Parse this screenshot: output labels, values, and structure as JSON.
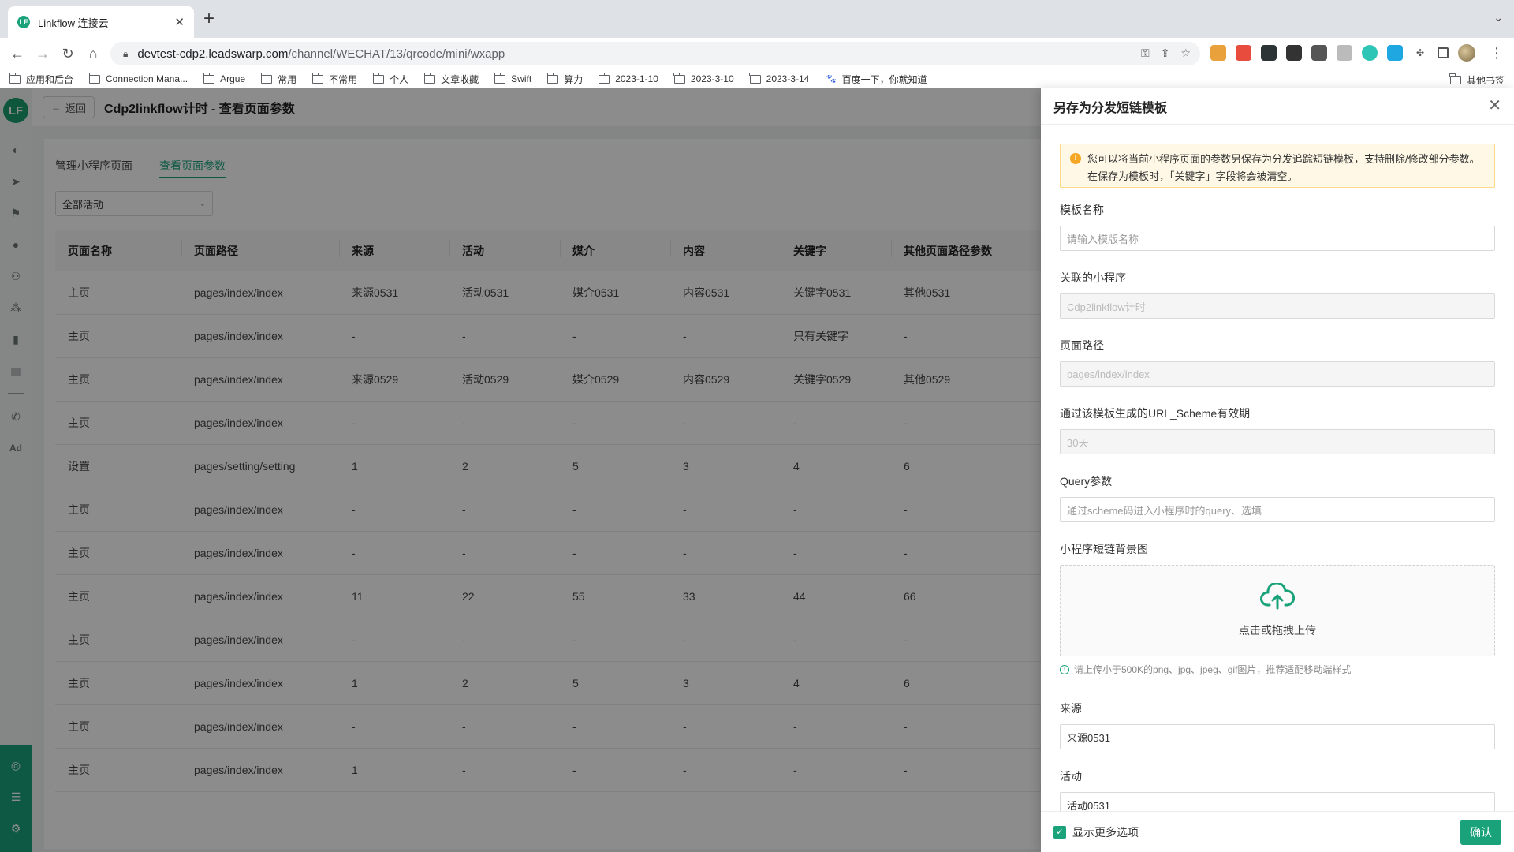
{
  "browser": {
    "tab_title": "Linkflow 连接云",
    "tab_favicon": "LF",
    "url_host": "devtest-cdp2.leadswarp.com",
    "url_path": "/channel/WECHAT/13/qrcode/mini/wxapp",
    "bookmarks": [
      "应用和后台",
      "Connection Mana...",
      "Argue",
      "常用",
      "不常用",
      "个人",
      "文章收藏",
      "Swift",
      "算力",
      "2023-1-10",
      "2023-3-10",
      "2023-3-14"
    ],
    "baidu_bookmark": "百度一下，你就知道",
    "other_bookmarks": "其他书签"
  },
  "page": {
    "back_label": "返回",
    "title": "Cdp2linkflow计时 - 查看页面参数",
    "tabs": [
      "管理小程序页面",
      "查看页面参数"
    ],
    "filter_value": "全部活动"
  },
  "table": {
    "headers": [
      "页面名称",
      "页面路径",
      "来源",
      "活动",
      "媒介",
      "内容",
      "关键字",
      "其他页面路径参数"
    ],
    "rows": [
      [
        "主页",
        "pages/index/index",
        "来源0531",
        "活动0531",
        "媒介0531",
        "内容0531",
        "关键字0531",
        "其他0531"
      ],
      [
        "主页",
        "pages/index/index",
        "-",
        "-",
        "-",
        "-",
        "只有关键字",
        "-"
      ],
      [
        "主页",
        "pages/index/index",
        "来源0529",
        "活动0529",
        "媒介0529",
        "内容0529",
        "关键字0529",
        "其他0529"
      ],
      [
        "主页",
        "pages/index/index",
        "-",
        "-",
        "-",
        "-",
        "-",
        "-"
      ],
      [
        "设置",
        "pages/setting/setting",
        "1",
        "2",
        "5",
        "3",
        "4",
        "6"
      ],
      [
        "主页",
        "pages/index/index",
        "-",
        "-",
        "-",
        "-",
        "-",
        "-"
      ],
      [
        "主页",
        "pages/index/index",
        "-",
        "-",
        "-",
        "-",
        "-",
        "-"
      ],
      [
        "主页",
        "pages/index/index",
        "11",
        "22",
        "55",
        "33",
        "44",
        "66"
      ],
      [
        "主页",
        "pages/index/index",
        "-",
        "-",
        "-",
        "-",
        "-",
        "-"
      ],
      [
        "主页",
        "pages/index/index",
        "1",
        "2",
        "5",
        "3",
        "4",
        "6"
      ],
      [
        "主页",
        "pages/index/index",
        "-",
        "-",
        "-",
        "-",
        "-",
        "-"
      ],
      [
        "主页",
        "pages/index/index",
        "1",
        "-",
        "-",
        "-",
        "-",
        "-"
      ]
    ]
  },
  "drawer": {
    "title": "另存为分发短链模板",
    "alert": "您可以将当前小程序页面的参数另保存为分发追踪短链模板，支持删除/修改部分参数。在保存为模板时，「关键字」字段将会被清空。",
    "template_name_label": "模板名称",
    "template_name_placeholder": "请输入模版名称",
    "mini_program_label": "关联的小程序",
    "mini_program_value": "Cdp2linkflow计时",
    "page_path_label": "页面路径",
    "page_path_value": "pages/index/index",
    "scheme_label": "通过该模板生成的URL_Scheme有效期",
    "scheme_value": "30天",
    "query_label": "Query参数",
    "query_placeholder": "通过scheme码进入小程序时的query、选填",
    "bg_label": "小程序短链背景图",
    "upload_text": "点击或拖拽上传",
    "upload_hint": "请上传小于500K的png、jpg、jpeg、gif图片，推荐适配移动端样式",
    "source_label": "来源",
    "source_value": "来源0531",
    "activity_label": "活动",
    "activity_value": "活动0531",
    "show_more_label": "显示更多选项",
    "confirm_label": "确认"
  },
  "colors": {
    "brand": "#1aa37a",
    "warning": "#f5a623"
  }
}
